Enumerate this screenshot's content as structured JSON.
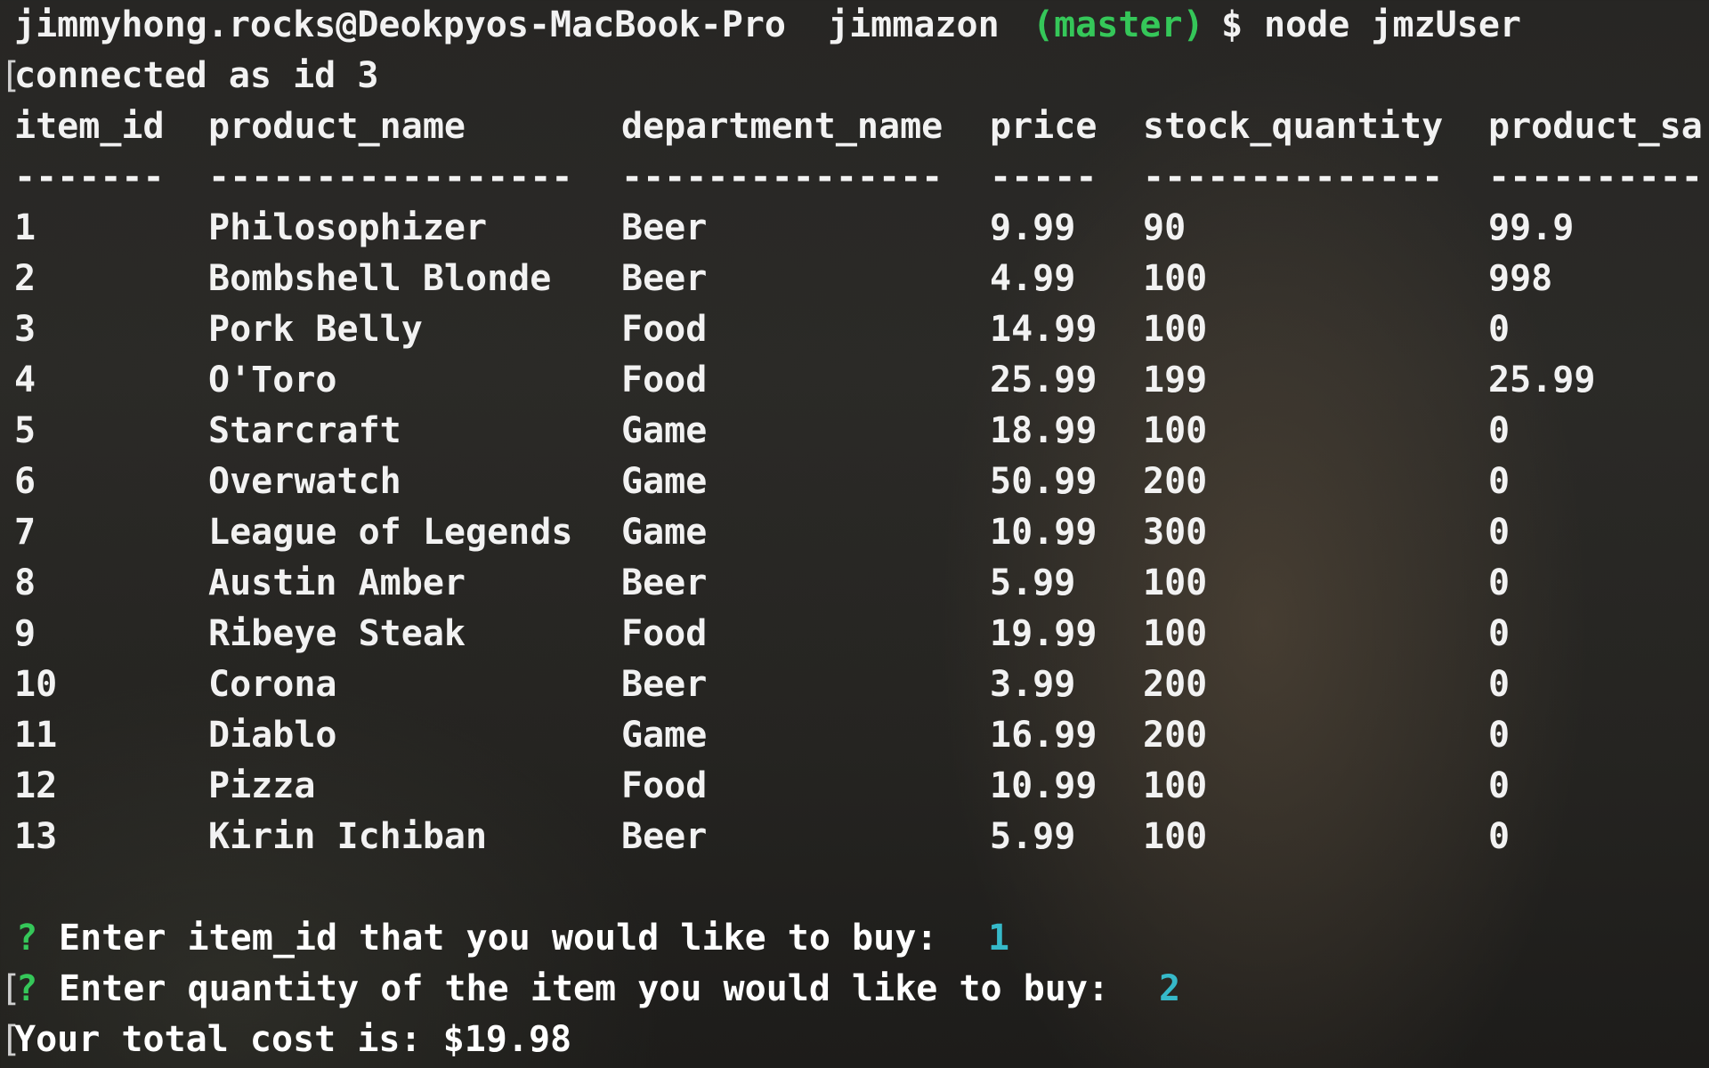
{
  "prompt": {
    "bracket": "[",
    "user_host": "jimmyhong.rocks@Deokpyos-MacBook-Pro",
    "directory": "jimmazon",
    "branch": "(master)",
    "symbol": "$",
    "command": "node jmzUser"
  },
  "connection_message": "connected as id 3",
  "table": {
    "headers": [
      "item_id",
      "product_name",
      "department_name",
      "price",
      "stock_quantity",
      "product_sa"
    ],
    "separators": [
      "-------",
      "-----------------",
      "---------------",
      "-----",
      "--------------",
      "----------"
    ],
    "rows": [
      [
        "1",
        "Philosophizer",
        "Beer",
        "9.99",
        "90",
        "99.9"
      ],
      [
        "2",
        "Bombshell Blonde",
        "Beer",
        "4.99",
        "100",
        "998"
      ],
      [
        "3",
        "Pork Belly",
        "Food",
        "14.99",
        "100",
        "0"
      ],
      [
        "4",
        "O'Toro",
        "Food",
        "25.99",
        "199",
        "25.99"
      ],
      [
        "5",
        "Starcraft",
        "Game",
        "18.99",
        "100",
        "0"
      ],
      [
        "6",
        "Overwatch",
        "Game",
        "50.99",
        "200",
        "0"
      ],
      [
        "7",
        "League of Legends",
        "Game",
        "10.99",
        "300",
        "0"
      ],
      [
        "8",
        "Austin Amber",
        "Beer",
        "5.99",
        "100",
        "0"
      ],
      [
        "9",
        "Ribeye Steak",
        "Food",
        "19.99",
        "100",
        "0"
      ],
      [
        "10",
        "Corona",
        "Beer",
        "3.99",
        "200",
        "0"
      ],
      [
        "11",
        "Diablo",
        "Game",
        "16.99",
        "200",
        "0"
      ],
      [
        "12",
        "Pizza",
        "Food",
        "10.99",
        "100",
        "0"
      ],
      [
        "13",
        "Kirin Ichiban",
        "Beer",
        "5.99",
        "100",
        "0"
      ]
    ]
  },
  "questions": [
    {
      "bracket": "[",
      "mark": "?",
      "text": "Enter item_id that you would like to buy:",
      "answer": "1"
    },
    {
      "bracket": "[",
      "mark": "?",
      "text": "Enter quantity of the item you would like to buy:",
      "answer": "2"
    }
  ],
  "result": "Your total cost is: $19.98",
  "colors": {
    "branch": "#35c759",
    "answer": "#36b9c9",
    "question_mark": "#35c759",
    "text": "#f2f2f2"
  }
}
